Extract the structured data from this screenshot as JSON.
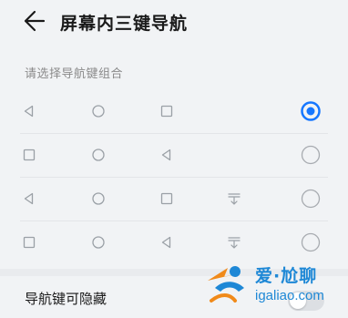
{
  "header": {
    "title": "屏幕内三键导航"
  },
  "section_label": "请选择导航键组合",
  "options": [
    {
      "keys": [
        "back-triangle",
        "home-circle",
        "recent-square"
      ],
      "selected": true
    },
    {
      "keys": [
        "recent-square",
        "home-circle",
        "back-triangle"
      ],
      "selected": false
    },
    {
      "keys": [
        "back-triangle",
        "home-circle",
        "recent-square",
        "notification-down"
      ],
      "selected": false
    },
    {
      "keys": [
        "recent-square",
        "home-circle",
        "back-triangle",
        "notification-down"
      ],
      "selected": false
    }
  ],
  "hide_nav": {
    "label": "导航键可隐藏",
    "enabled": false
  },
  "watermark": {
    "title": "爱·尬聊",
    "domain": "igaliao.com"
  },
  "colors": {
    "accent": "#1677ff",
    "icon": "#9aa0a6"
  }
}
